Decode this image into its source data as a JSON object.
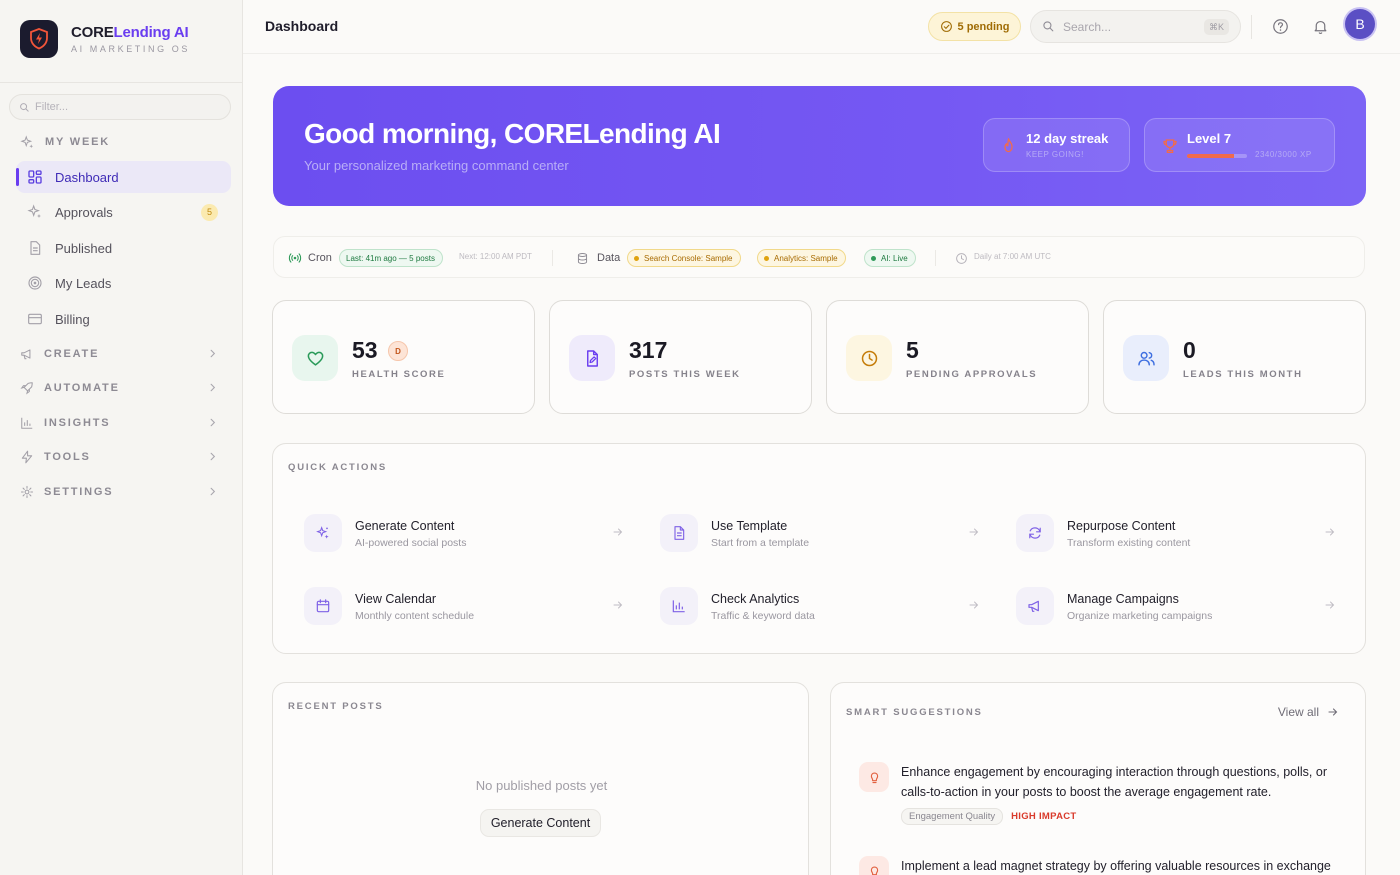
{
  "brand": {
    "name_part1": "CORE",
    "name_part2": "Lending AI",
    "subtitle": "AI MARKETING OS"
  },
  "sidebar": {
    "filter_placeholder": "Filter...",
    "my_week_label": "MY WEEK",
    "items": [
      {
        "label": "Dashboard",
        "icon": "grid-icon",
        "active": true
      },
      {
        "label": "Approvals",
        "icon": "sparkle-icon",
        "badge": "5"
      },
      {
        "label": "Published",
        "icon": "document-icon"
      },
      {
        "label": "My Leads",
        "icon": "target-icon"
      },
      {
        "label": "Billing",
        "icon": "card-icon"
      }
    ],
    "sections": [
      {
        "label": "CREATE",
        "icon": "megaphone-icon"
      },
      {
        "label": "AUTOMATE",
        "icon": "rocket-icon"
      },
      {
        "label": "INSIGHTS",
        "icon": "bar-chart-icon"
      },
      {
        "label": "TOOLS",
        "icon": "bolt-icon"
      },
      {
        "label": "SETTINGS",
        "icon": "gear-icon"
      }
    ]
  },
  "topbar": {
    "title": "Dashboard",
    "pending_label": "5 pending",
    "search_placeholder": "Search...",
    "search_shortcut": "⌘K",
    "avatar_initial": "B"
  },
  "hero": {
    "greeting": "Good morning, CORELending AI",
    "subtitle": "Your personalized marketing command center",
    "streak_title": "12 day streak",
    "streak_sub": "KEEP GOING!",
    "level_title": "Level 7",
    "xp_text": "2340/3000 XP",
    "xp_progress": 0.78
  },
  "status": {
    "cron_label": "Cron",
    "cron_last": "Last: 41m ago — 5 posts",
    "cron_next": "Next: 12:00 AM PDT",
    "data_label": "Data",
    "search_console": "Search Console: Sample",
    "analytics": "Analytics: Sample",
    "ai": "AI: Live",
    "schedule": "Daily at 7:00 AM UTC"
  },
  "stats": [
    {
      "value": "53",
      "label": "HEALTH SCORE",
      "grade": "D",
      "icon": "heart-icon"
    },
    {
      "value": "317",
      "label": "POSTS THIS WEEK",
      "icon": "file-edit-icon"
    },
    {
      "value": "5",
      "label": "PENDING APPROVALS",
      "icon": "clock-icon"
    },
    {
      "value": "0",
      "label": "LEADS THIS MONTH",
      "icon": "users-icon"
    }
  ],
  "quick_actions": {
    "heading": "QUICK ACTIONS",
    "items": [
      {
        "title": "Generate Content",
        "sub": "AI-powered social posts",
        "icon": "sparkle-icon"
      },
      {
        "title": "Use Template",
        "sub": "Start from a template",
        "icon": "document-icon"
      },
      {
        "title": "Repurpose Content",
        "sub": "Transform existing content",
        "icon": "refresh-icon"
      },
      {
        "title": "View Calendar",
        "sub": "Monthly content schedule",
        "icon": "calendar-icon"
      },
      {
        "title": "Check Analytics",
        "sub": "Traffic & keyword data",
        "icon": "bar-chart-icon"
      },
      {
        "title": "Manage Campaigns",
        "sub": "Organize marketing campaigns",
        "icon": "megaphone-icon"
      }
    ]
  },
  "recent_posts": {
    "heading": "RECENT POSTS",
    "empty_text": "No published posts yet",
    "button_label": "Generate Content"
  },
  "smart": {
    "heading": "SMART SUGGESTIONS",
    "view_all": "View all",
    "items": [
      {
        "text": "Enhance engagement by encouraging interaction through questions, polls, or calls-to-action in your posts to boost the average engagement rate.",
        "category": "Engagement Quality",
        "impact": "HIGH IMPACT"
      },
      {
        "text": "Implement a lead magnet strategy by offering valuable resources in exchange"
      }
    ]
  },
  "colors": {
    "accent": "#6a3df0",
    "hero": "#6c4ef0",
    "impact": "#d93a2b"
  }
}
